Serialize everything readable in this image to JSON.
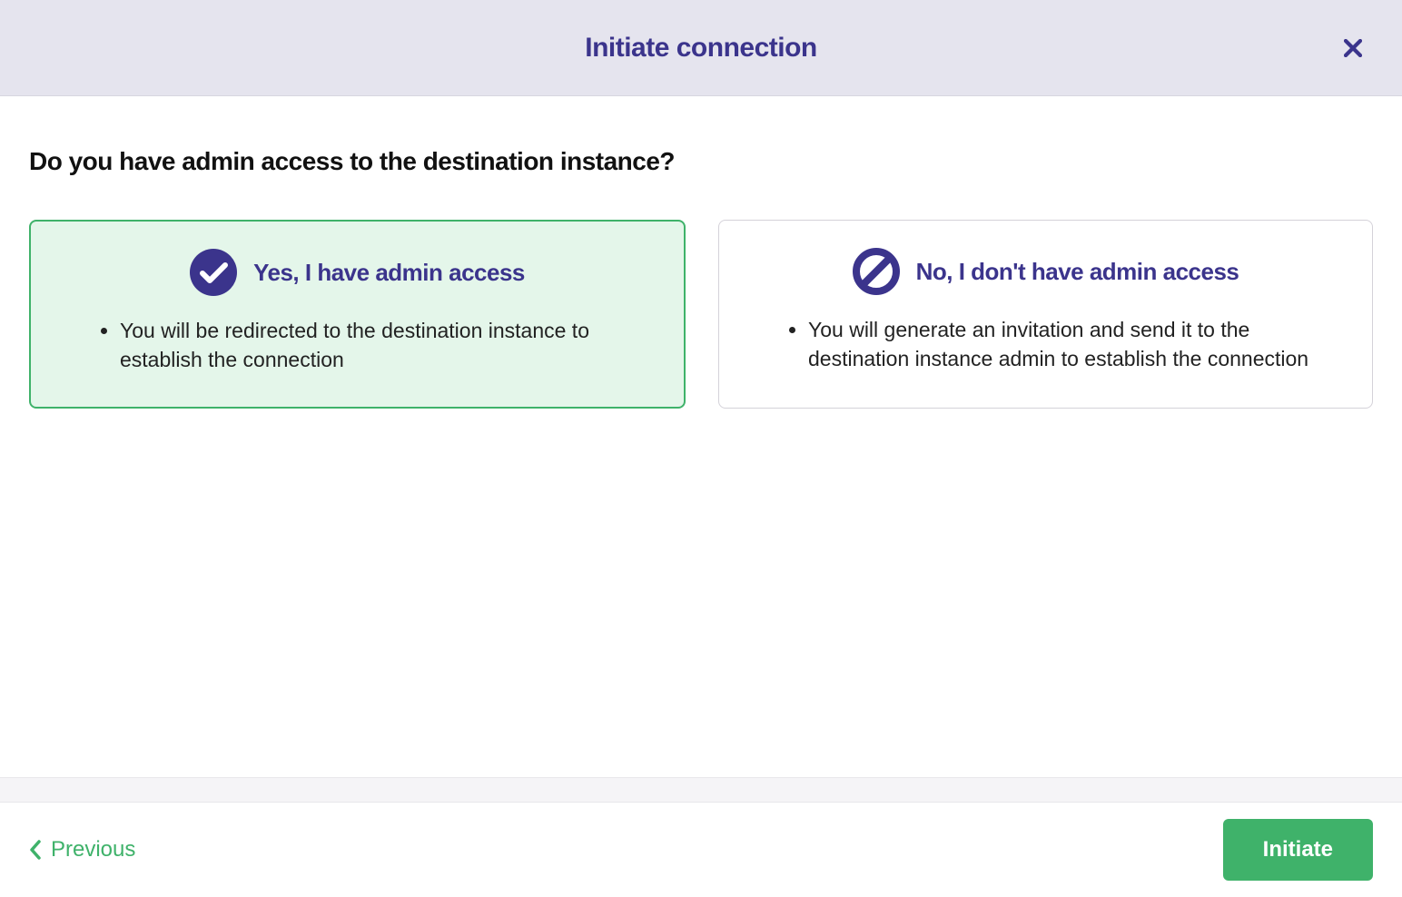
{
  "header": {
    "title": "Initiate connection"
  },
  "main": {
    "question": "Do you have admin access to the destination instance?",
    "options": {
      "yes": {
        "title": "Yes, I have admin access",
        "description": "You will be redirected to the destination instance to establish the connection",
        "icon": "check-circle-icon",
        "selected": true
      },
      "no": {
        "title": "No, I don't have admin access",
        "description": "You will generate an invitation and send it to the destination instance admin to establish the connection",
        "icon": "prohibit-icon",
        "selected": false
      }
    }
  },
  "footer": {
    "previous_label": "Previous",
    "initiate_label": "Initiate"
  },
  "colors": {
    "brand": "#3b348c",
    "accent_green": "#3fb26a",
    "selected_bg": "#e4f6ea",
    "header_bg": "#e5e4ee"
  }
}
